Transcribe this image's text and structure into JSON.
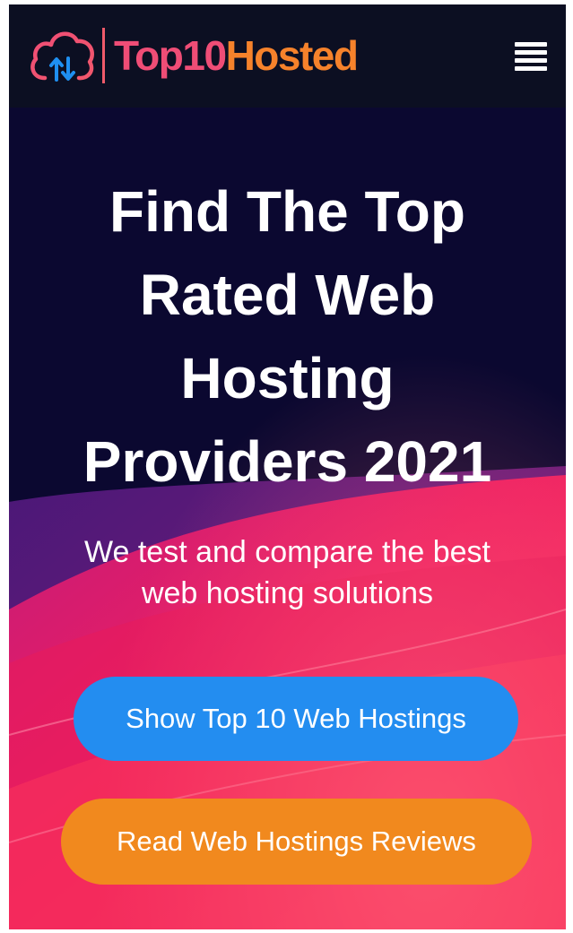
{
  "header": {
    "logo": {
      "icon": "cloud-transfer-icon",
      "text_part1": "Top10",
      "text_part2": "Hosted",
      "colors": {
        "pink": "#ef4d76",
        "orange": "#f6822b",
        "background": "#0c0f22"
      }
    },
    "menu": {
      "icon": "hamburger-menu-icon"
    }
  },
  "hero": {
    "title_lines": [
      "Find The Top",
      "Rated Web",
      "Hosting",
      "Providers 2021"
    ],
    "subtitle_lines": [
      "We test and compare the best",
      "web hosting solutions"
    ],
    "colors": {
      "background": "#0b0830",
      "wave_pink": "#ee1f62",
      "wave_purple": "#6a1a8a"
    }
  },
  "buttons": {
    "primary": {
      "label": "Show Top 10 Web Hostings",
      "color": "#238df0"
    },
    "secondary": {
      "label": "Read Web Hostings Reviews",
      "color": "#f1891e"
    }
  }
}
